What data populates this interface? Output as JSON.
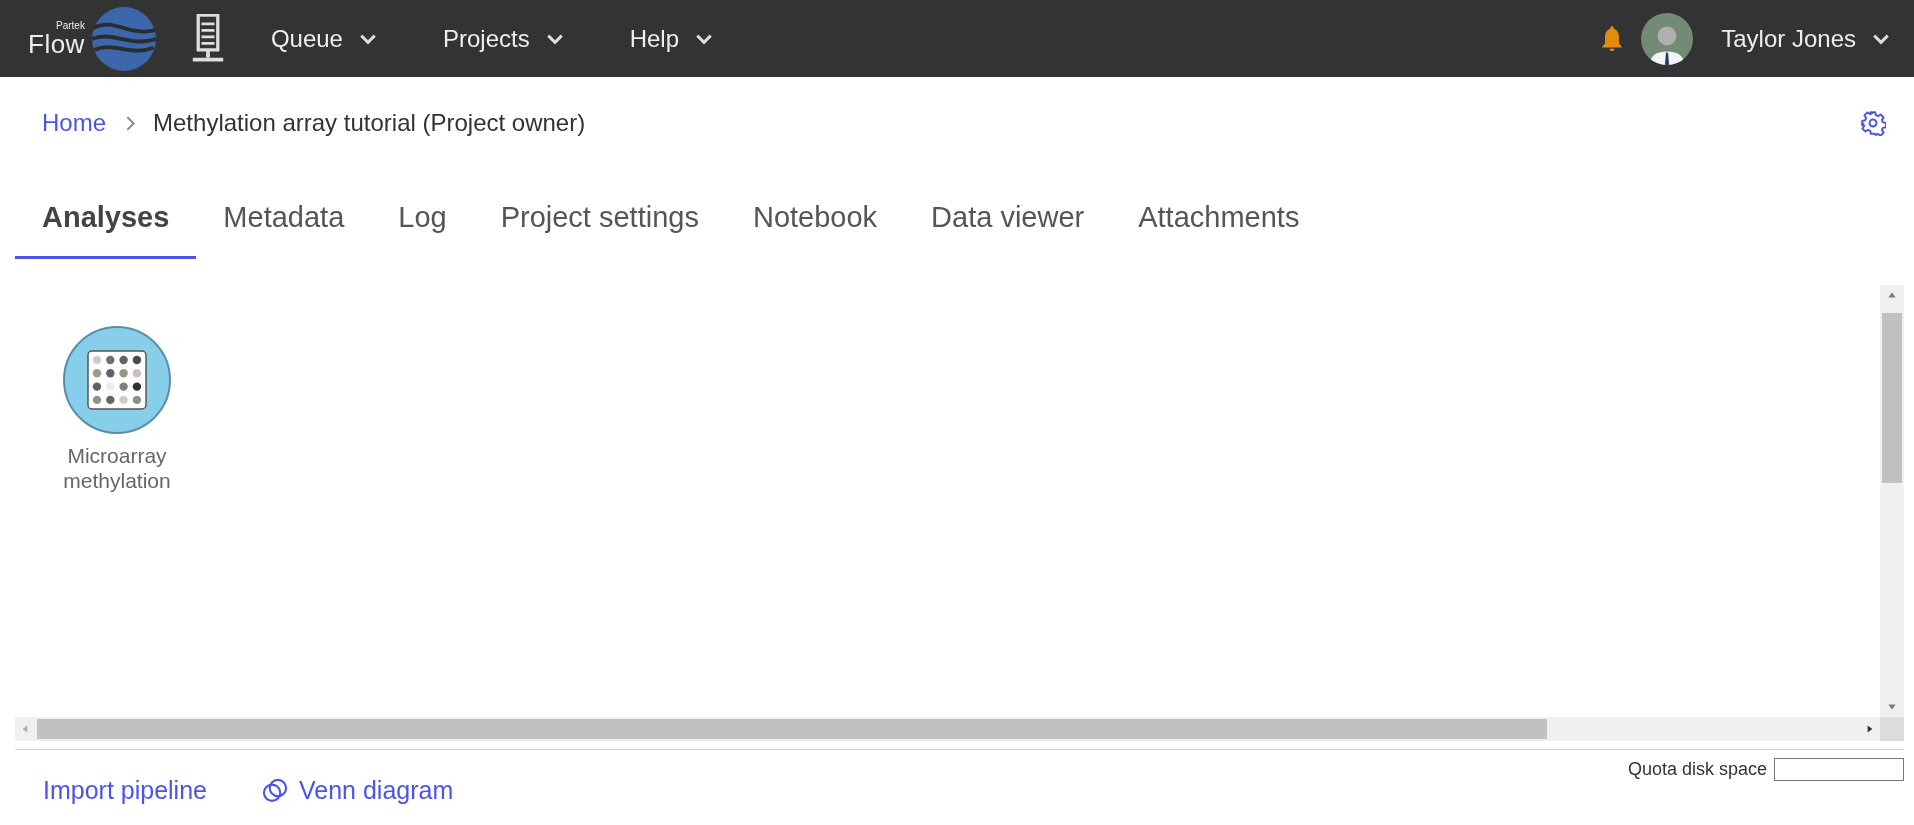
{
  "header": {
    "logo": {
      "brand": "Partek",
      "product": "Flow"
    },
    "menus": [
      {
        "label": "Queue"
      },
      {
        "label": "Projects"
      },
      {
        "label": "Help"
      }
    ],
    "user": {
      "name": "Taylor Jones"
    }
  },
  "breadcrumb": [
    {
      "label": "Home",
      "link": true
    },
    {
      "label": "Methylation array tutorial (Project owner)",
      "link": false
    }
  ],
  "tabs": [
    {
      "label": "Analyses",
      "selected": true
    },
    {
      "label": "Metadata",
      "selected": false
    },
    {
      "label": "Log",
      "selected": false
    },
    {
      "label": "Project settings",
      "selected": false
    },
    {
      "label": "Notebook",
      "selected": false
    },
    {
      "label": "Data viewer",
      "selected": false
    },
    {
      "label": "Attachments",
      "selected": false
    }
  ],
  "nodes": [
    {
      "label": "Microarray methylation"
    }
  ],
  "footer": {
    "links": [
      {
        "label": "Import pipeline",
        "kind": "plain"
      },
      {
        "label": "Venn diagram",
        "kind": "venn"
      }
    ],
    "quota": {
      "label": "Quota disk space"
    }
  }
}
